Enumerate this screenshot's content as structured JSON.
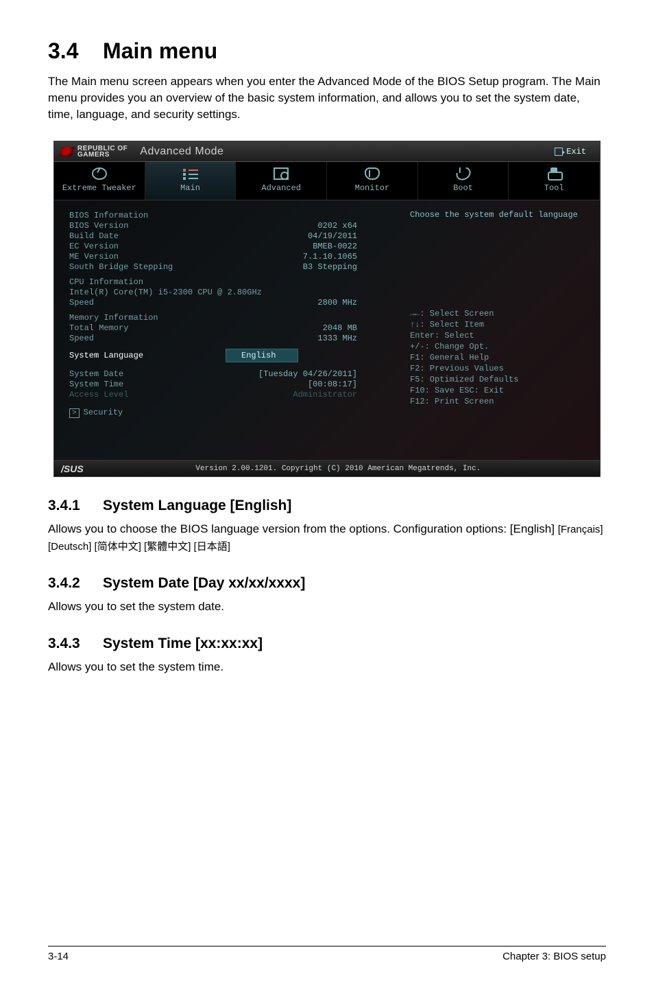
{
  "doc": {
    "title_num": "3.4",
    "title_text": "Main menu",
    "intro": "The Main menu screen appears when you enter the Advanced Mode of the BIOS Setup program. The Main menu provides you an overview of the basic system information, and allows you to set the system date, time, language, and security settings.",
    "sub1_num": "3.4.1",
    "sub1_title": "System Language [English]",
    "sub1_body_a": "Allows you to choose the BIOS language version from the options. Configuration options: [English] ",
    "sub1_body_b": "[Français] [Deutsch] [简体中文] [繁體中文] [日本語]",
    "sub2_num": "3.4.2",
    "sub2_title": "System Date [Day xx/xx/xxxx]",
    "sub2_body": "Allows you to set the system date.",
    "sub3_num": "3.4.3",
    "sub3_title": "System Time [xx:xx:xx]",
    "sub3_body": "Allows you to set the system time.",
    "footer_left": "3-14",
    "footer_right": "Chapter 3: BIOS setup"
  },
  "bios": {
    "brand_line1": "REPUBLIC OF",
    "brand_line2": "GAMERS",
    "mode_label": "Advanced Mode",
    "exit_label": "Exit",
    "tabs": {
      "extreme": "Extreme Tweaker",
      "main": "Main",
      "advanced": "Advanced",
      "monitor": "Monitor",
      "boot": "Boot",
      "tool": "Tool"
    },
    "info": {
      "section1": "BIOS Information",
      "bios_version_l": "BIOS Version",
      "bios_version_v": "0202 x64",
      "build_date_l": "Build Date",
      "build_date_v": "04/19/2011",
      "ec_version_l": "EC Version",
      "ec_version_v": "BMEB-0022",
      "me_version_l": "ME Version",
      "me_version_v": "7.1.10.1065",
      "sb_step_l": "South Bridge Stepping",
      "sb_step_v": "B3 Stepping",
      "section2": "CPU Information",
      "cpu_name": "Intel(R) Core(TM) i5-2300 CPU @ 2.80GHz",
      "cpu_speed_l": "Speed",
      "cpu_speed_v": "2800 MHz",
      "section3": "Memory Information",
      "total_mem_l": "Total Memory",
      "total_mem_v": "2048 MB",
      "mem_speed_l": "Speed",
      "mem_speed_v": "1333 MHz",
      "sys_lang_l": "System Language",
      "sys_lang_v": "English",
      "sys_date_l": "System Date",
      "sys_date_v": "[Tuesday 04/26/2011]",
      "sys_time_l": "System Time",
      "sys_time_v": "[00:08:17]",
      "access_l": "Access Level",
      "access_v": "Administrator",
      "security_l": "Security"
    },
    "help": "Choose the system default language",
    "hints": {
      "h1": "→←: Select Screen",
      "h2": "↑↓: Select Item",
      "h3": "Enter: Select",
      "h4": "+/-: Change Opt.",
      "h5": "F1: General Help",
      "h6": "F2: Previous Values",
      "h7": "F5: Optimized Defaults",
      "h8": "F10: Save  ESC: Exit",
      "h9": "F12: Print Screen"
    },
    "version": "Version 2.00.1201. Copyright (C) 2010 American Megatrends, Inc.",
    "asus": "/SUS"
  }
}
